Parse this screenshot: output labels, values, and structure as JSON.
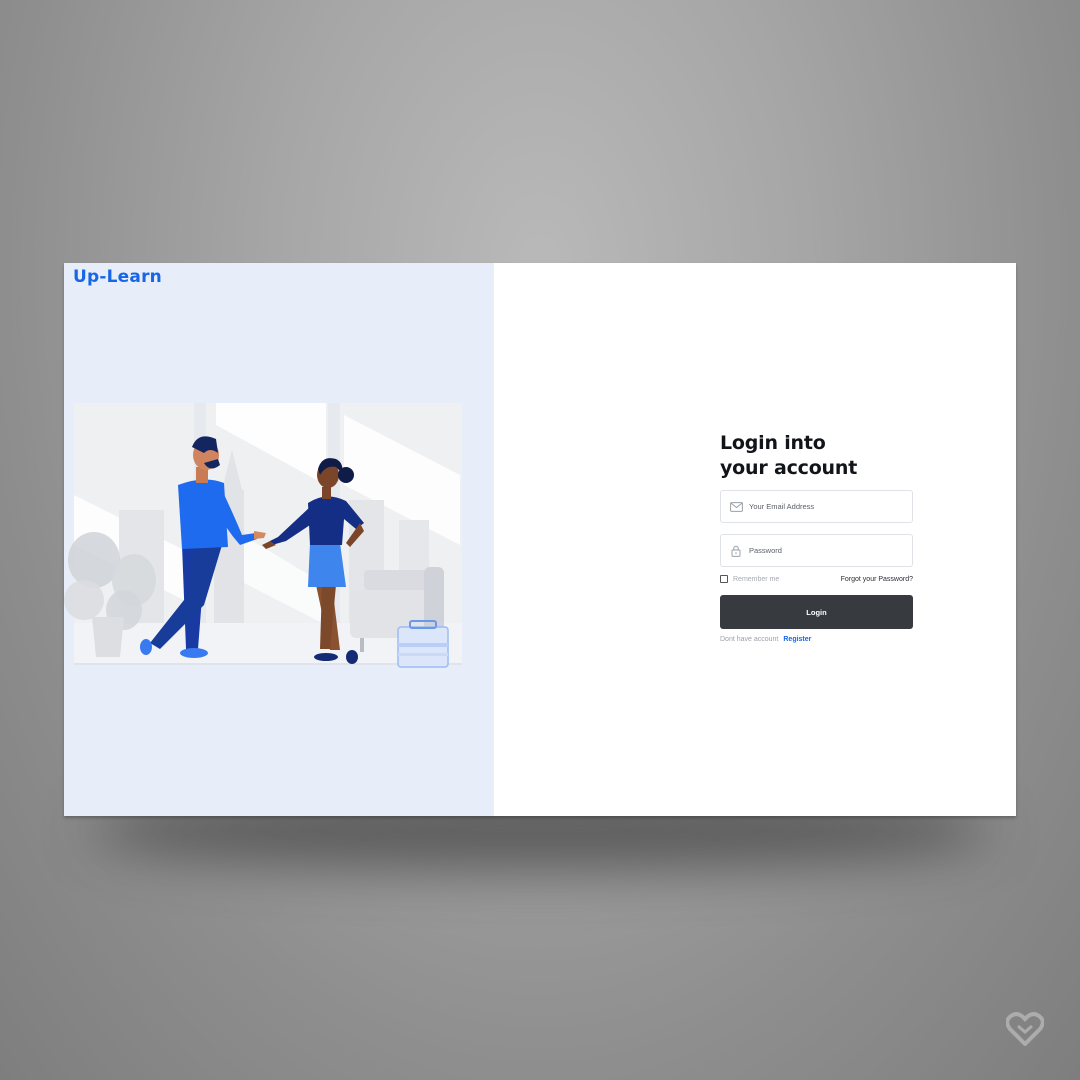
{
  "brand": {
    "name": "Up-Learn",
    "color": "#1766e6"
  },
  "left_panel": {
    "background": "#e7eef9",
    "illustration": "two-people-talking-office-illustration"
  },
  "login": {
    "heading_line1": "Login into",
    "heading_line2": "your account",
    "email": {
      "placeholder": "Your Email Address",
      "value": "",
      "icon": "mail-icon"
    },
    "password": {
      "placeholder": "Password",
      "value": "",
      "icon": "lock-icon"
    },
    "remember_label": "Remember me",
    "remember_checked": false,
    "forgot_label": "Forgot your Password?",
    "button_label": "Login",
    "button_color": "#373a3f",
    "register_prompt": "Dont have account",
    "register_label": "Register"
  },
  "watermark": {
    "icon": "heart-logo-icon"
  }
}
